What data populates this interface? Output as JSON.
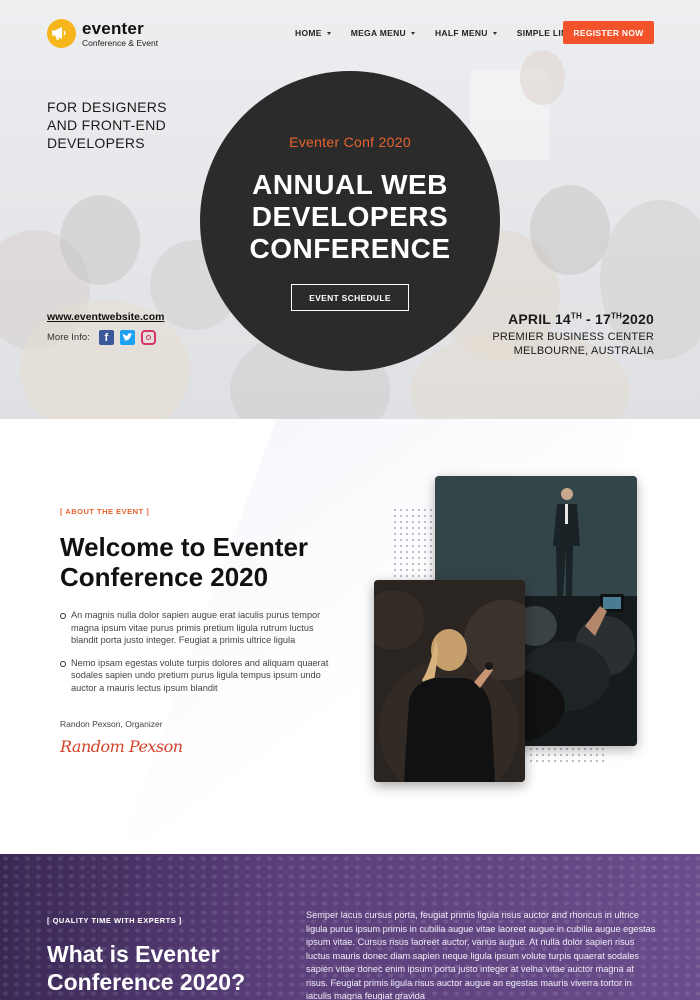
{
  "brand": {
    "name": "eventer",
    "subtitle": "Conference & Event"
  },
  "nav": {
    "items": [
      {
        "label": "HOME",
        "dropdown": true
      },
      {
        "label": "MEGA MENU",
        "dropdown": true
      },
      {
        "label": "HALF MENU",
        "dropdown": true
      },
      {
        "label": "SIMPLE LINK",
        "dropdown": false
      }
    ],
    "register_label": "REGISTER NOW"
  },
  "hero": {
    "tagline_lines": [
      "FOR DESIGNERS",
      "AND FRONT-END",
      "DEVELOPERS"
    ],
    "conf_name": "Eventer Conf 2020",
    "title_lines": [
      "ANNUAL WEB",
      "DEVELOPERS",
      "CONFERENCE"
    ],
    "schedule_label": "EVENT SCHEDULE",
    "website": "www.eventwebsite.com",
    "more_info_label": "More Info:",
    "date": {
      "month_start": "APRIL 14",
      "start_suffix": "TH",
      "sep": " - 17",
      "end_suffix": "TH",
      "year": "2020"
    },
    "venue_lines": [
      "PREMIER BUSINESS CENTER",
      "MELBOURNE, AUSTRALIA"
    ]
  },
  "about": {
    "tag": "[ ABOUT THE EVENT ]",
    "title_lines": [
      "Welcome to Eventer",
      "Conference 2020"
    ],
    "bullets": [
      "An magnis nulla dolor sapien augue erat iaculis purus tempor magna ipsum vitae purus primis pretium ligula rutrum luctus blandit porta justo integer. Feugiat a primis ultrice ligula",
      "Nemo ipsam egestas volute turpis dolores and aliquam quaerat sodales sapien undo pretium purus ligula tempus ipsum undo auctor a mauris lectus ipsum blandit"
    ],
    "organizer": "Randon Pexson, Organizer",
    "signature": "Random Pexson"
  },
  "experts": {
    "tag": "[ QUALITY TIME WITH EXPERTS ]",
    "title_lines": [
      "What is Eventer",
      "Conference 2020?"
    ],
    "paragraph": "Semper lacus cursus porta, feugiat primis ligula risus auctor and rhoncus in ultrice ligula purus ipsum primis in cubilia augue vitae laoreet augue in cubilia augue egestas ipsum vitae. Cursus risus laoreet auctor, varius augue. At nulla dolor sapien risus luctus mauris donec diam sapien neque ligula ipsum volute turpis quaerat sodales sapien vitae donec enim ipsum porta justo integer at velna vitae auctor magna at risus. Feugiat primis ligula risus auctor augue an egestas mauris viverra tortor in iaculis magna feugiat gravida"
  },
  "colors": {
    "accent": "#f2532b",
    "accent_text": "#e8632d",
    "dark_circle": "#2b2b2b",
    "purple": "#5a3f7a"
  }
}
